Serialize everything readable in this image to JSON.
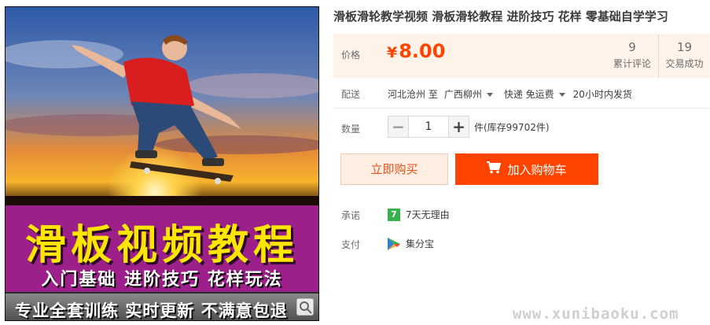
{
  "product": {
    "title": "滑板滑轮教学视频 滑板滑轮教程 进阶技巧 花样 零基础自学学习"
  },
  "gallery": {
    "banner_main": "滑板视频教程",
    "banner_sub": "入门基础  进阶技巧  花样玩法",
    "banner_bottom": "专业全套训练  实时更新  不满意包退"
  },
  "price": {
    "label": "价格",
    "currency": "¥",
    "value": "8.00",
    "stats": [
      {
        "num": "9",
        "label": "累计评论"
      },
      {
        "num": "19",
        "label": "交易成功"
      }
    ]
  },
  "shipping": {
    "label": "配送",
    "from": "河北沧州 至",
    "to": "广西柳州",
    "method": "快递 免运费",
    "dispatch": "20小时内发货"
  },
  "quantity": {
    "label": "数量",
    "minus": "−",
    "value": "1",
    "plus": "+",
    "stock": "件(库存99702件)"
  },
  "actions": {
    "buy_now": "立即购买",
    "add_cart": "加入购物车"
  },
  "promise": {
    "label": "承诺",
    "icon_text": "7",
    "text": "7天无理由"
  },
  "payment": {
    "label": "支付",
    "text": "集分宝"
  },
  "watermark": "www.xunibaoku.com",
  "colors": {
    "accent": "#ff4400",
    "price_bg": "#fff2e8",
    "banner_purple": "#9c1f8a",
    "banner_yellow": "#ffe600",
    "promise_green": "#36b24a"
  },
  "icons": {
    "zoom": "magnifier-icon",
    "cart": "shopping-cart-icon",
    "promise": "seven-day-badge-icon",
    "payment": "jifenbao-icon"
  }
}
